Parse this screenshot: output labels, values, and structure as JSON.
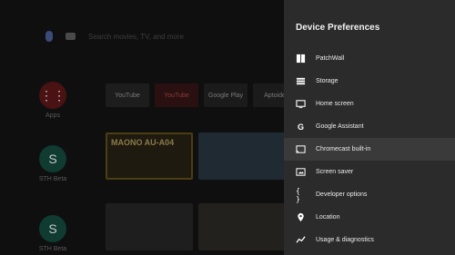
{
  "home": {
    "search_placeholder": "Search movies, TV, and more",
    "rail": [
      {
        "label": "Apps"
      },
      {
        "label": "STH Beta"
      },
      {
        "label": "STH Beta"
      }
    ],
    "apps": [
      {
        "label": "YouTube"
      },
      {
        "label": "YouTube"
      },
      {
        "label": "Google Play"
      },
      {
        "label": "Aptoide"
      }
    ],
    "cards": [
      {
        "label": "MAONO AU-A04"
      }
    ]
  },
  "panel": {
    "title": "Device Preferences",
    "items": [
      {
        "label": "PatchWall",
        "icon": "patchwall-icon"
      },
      {
        "label": "Storage",
        "icon": "storage-icon"
      },
      {
        "label": "Home screen",
        "icon": "home-screen-icon"
      },
      {
        "label": "Google Assistant",
        "icon": "google-icon"
      },
      {
        "label": "Chromecast built-in",
        "icon": "cast-icon"
      },
      {
        "label": "Screen saver",
        "icon": "screen-saver-icon"
      },
      {
        "label": "Developer options",
        "icon": "braces-icon"
      },
      {
        "label": "Location",
        "icon": "location-icon"
      },
      {
        "label": "Usage & diagnostics",
        "icon": "chart-icon"
      }
    ]
  }
}
